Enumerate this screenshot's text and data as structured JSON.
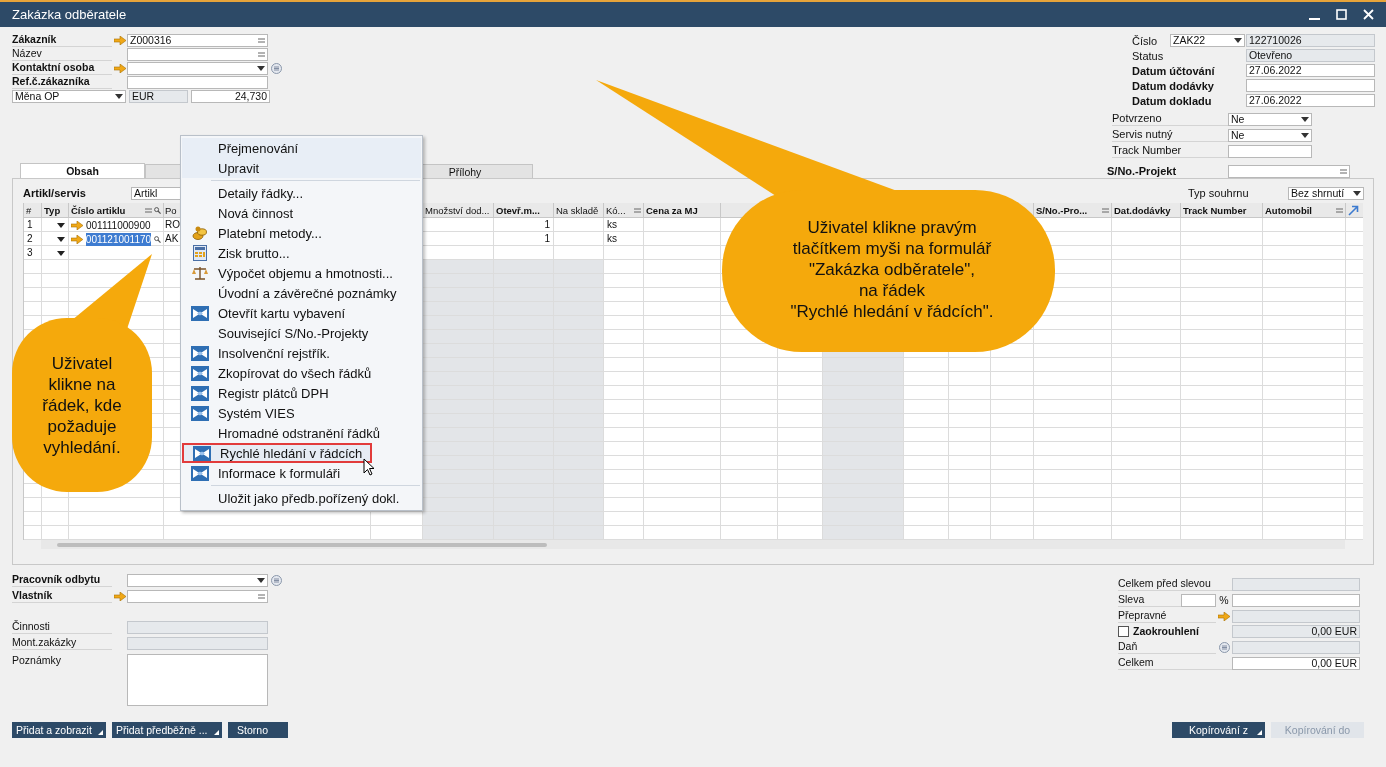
{
  "window": {
    "title": "Zakázka odběratele"
  },
  "customer": {
    "fields": [
      {
        "label": "Zákazník",
        "bold": true,
        "link": true,
        "list_button": true,
        "info": false,
        "kind": "text",
        "value": "Z000316"
      },
      {
        "label": "Název",
        "bold": false,
        "link": false,
        "list_button": true,
        "info": false,
        "kind": "text"
      },
      {
        "label": "Kontaktní osoba",
        "bold": true,
        "link": true,
        "list_button": false,
        "kind": "dropdown",
        "info": true
      },
      {
        "label": "Ref.č.zákazníka",
        "bold": true,
        "link": false,
        "list_button": false,
        "info": false,
        "kind": "text"
      }
    ],
    "currency": {
      "type": "Měna OP",
      "code": "EUR",
      "rate": "24,730"
    }
  },
  "document": {
    "fields": [
      {
        "label": "Číslo",
        "bold": false,
        "series": "ZAK22",
        "value": "122710026",
        "readonly": true
      },
      {
        "label": "Status",
        "bold": false,
        "value": "Otevřeno",
        "readonly": true
      },
      {
        "label": "Datum účtování",
        "bold": true,
        "value": "27.06.2022",
        "readonly": false
      },
      {
        "label": "Datum dodávky",
        "bold": true,
        "readonly": false
      },
      {
        "label": "Datum dokladu",
        "bold": true,
        "value": "27.06.2022",
        "readonly": false
      }
    ],
    "user_fields": [
      {
        "label": "Potvrzeno",
        "kind": "dropdown",
        "value": "Ne"
      },
      {
        "label": "Servis nutný",
        "kind": "dropdown",
        "value": "Ne"
      },
      {
        "label": "Track Number",
        "kind": "text"
      }
    ]
  },
  "tabs": [
    {
      "label": "Obsah",
      "selected": true
    },
    {
      "selected": false
    },
    {
      "label": "Přílohy",
      "selected": false
    }
  ],
  "project": {
    "label": "S/No.-Projekt"
  },
  "contents": {
    "item_type": {
      "label": "Artikl/servis",
      "value": "Artikl"
    },
    "summary": {
      "label": "Typ souhrnu",
      "value": "Bez shrnutí"
    },
    "columns": [
      {
        "label": "#",
        "bold": false,
        "menu": false,
        "search": false,
        "shaded": false
      },
      {
        "label": "Typ",
        "bold": true,
        "menu": false,
        "search": false,
        "shaded": false
      },
      {
        "label": "Číslo artiklu",
        "bold": true,
        "menu": true,
        "search": true,
        "shaded": false
      },
      {
        "label": "Po",
        "bold": false,
        "menu": false,
        "search": false,
        "shaded": false
      },
      {
        "shaded": false
      },
      {
        "label": "Množství dod...",
        "bold": false,
        "menu": false,
        "search": false,
        "shaded": true
      },
      {
        "label": "Otevř.m...",
        "bold": true,
        "menu": false,
        "search": false,
        "shaded": true
      },
      {
        "label": "Na skladě",
        "bold": false,
        "menu": false,
        "search": false,
        "shaded": true
      },
      {
        "label": "Kó...",
        "bold": false,
        "menu": true,
        "search": false,
        "shaded": false
      },
      {
        "label": "Cena za MJ",
        "bold": true,
        "menu": false,
        "search": false,
        "shaded": false
      },
      {
        "shaded": false
      },
      {
        "shaded": false
      },
      {
        "shaded": true
      },
      {
        "shaded": false
      },
      {
        "shaded": false
      },
      {
        "shaded": false
      },
      {
        "label": "S/No.-Pro...",
        "bold": true,
        "menu": true,
        "search": false,
        "shaded": false
      },
      {
        "label": "Dat.dodávky",
        "bold": true,
        "menu": false,
        "search": false,
        "shaded": false
      },
      {
        "label": "Track Number",
        "bold": true,
        "menu": false,
        "search": false,
        "shaded": false
      },
      {
        "label": "Automobil",
        "bold": true,
        "menu": true,
        "search": false,
        "shaded": false
      }
    ],
    "rows": [
      {
        "number": "1",
        "link": true,
        "item": "001111000900",
        "item_selected": false,
        "column_4": "RO",
        "open_qty": "1",
        "uom": "ks"
      },
      {
        "number": "2",
        "link": true,
        "item": "001121001170",
        "item_selected": true,
        "column_4": "AK",
        "open_qty": "1",
        "uom": "ks"
      },
      {
        "number": "3",
        "link": false,
        "item_selected": false
      }
    ]
  },
  "context_menu": {
    "items": [
      {
        "label": "Přejmenování",
        "kind": "plain",
        "separator_before": false,
        "highlighted": false
      },
      {
        "label": "Upravit",
        "kind": "plain",
        "separator_before": false,
        "highlighted": false
      },
      {
        "label": "Detaily řádky...",
        "kind": "plain",
        "separator_before": true,
        "highlighted": false
      },
      {
        "label": "Nová činnost",
        "kind": "plain",
        "separator_before": false,
        "highlighted": false
      },
      {
        "label": "Platební metody...",
        "kind": "coins",
        "separator_before": false,
        "highlighted": false
      },
      {
        "label": "Zisk brutto...",
        "kind": "calculator",
        "separator_before": false,
        "highlighted": false
      },
      {
        "label": "Výpočet objemu a hmotnosti...",
        "kind": "scale",
        "separator_before": false,
        "highlighted": false
      },
      {
        "label": "Úvodní a závěrečné poznámky",
        "kind": "plain",
        "separator_before": false,
        "highlighted": false
      },
      {
        "label": "Otevřít kartu vybavení",
        "kind": "app",
        "separator_before": false,
        "highlighted": false
      },
      {
        "label": "Související S/No.-Projekty",
        "kind": "plain",
        "separator_before": false,
        "highlighted": false
      },
      {
        "label": "Insolvenční rejstřík.",
        "kind": "app",
        "separator_before": false,
        "highlighted": false
      },
      {
        "label": "Zkopírovat do všech řádků",
        "kind": "app",
        "separator_before": false,
        "highlighted": false
      },
      {
        "label": "Registr plátců DPH",
        "kind": "app",
        "separator_before": false,
        "highlighted": false
      },
      {
        "label": "Systém VIES",
        "kind": "app",
        "separator_before": false,
        "highlighted": false
      },
      {
        "label": "Hromadné odstranění řádků",
        "kind": "plain",
        "separator_before": false,
        "highlighted": false
      },
      {
        "label": "Rychlé hledání v řádcích",
        "kind": "app",
        "separator_before": false,
        "highlighted": true
      },
      {
        "label": "Informace k formuláři",
        "kind": "app",
        "separator_before": false,
        "highlighted": false
      },
      {
        "label": "Uložit jako předb.pořízený dokl.",
        "kind": "plain",
        "separator_before": true,
        "highlighted": false
      }
    ]
  },
  "callouts": [
    {
      "text": "Uživatel klikne pravým\ntlačítkem myši na formulář\n\"Zakázka odběratele\",\nna řádek\n\"Rychlé hledání v řádcích\"."
    },
    {
      "text": "Uživatel\nklikne na\nřádek, kde\npožaduje\nvyhledání."
    }
  ],
  "sales": {
    "fields": [
      {
        "label": "Pracovník odbytu",
        "bold": true,
        "kind": "dropdown",
        "link": false,
        "info": true
      },
      {
        "label": "Vlastník",
        "bold": true,
        "kind": "text",
        "link": true,
        "info": false
      },
      {
        "label": "Činnosti",
        "bold": false,
        "kind": "readonly",
        "link": false,
        "info": false
      },
      {
        "label": "Mont.zakázky",
        "bold": false,
        "kind": "readonly",
        "link": false,
        "info": false
      },
      {
        "label": "Poznámky",
        "bold": false,
        "kind": "textarea",
        "link": false,
        "info": false
      }
    ]
  },
  "totals": [
    {
      "label": "Celkem před slevou",
      "bold": false,
      "kind": "readonly"
    },
    {
      "label": "Sleva",
      "bold": false,
      "kind": "percent",
      "unit": "%"
    },
    {
      "label": "Přepravné",
      "bold": false,
      "kind": "link"
    },
    {
      "label": "Zaokrouhlení",
      "bold": true,
      "kind": "checkbox",
      "checked": false,
      "value": "0,00 EUR"
    },
    {
      "label": "Daň",
      "bold": false,
      "kind": "info"
    },
    {
      "label": "Celkem",
      "bold": false,
      "kind": "total",
      "value": "0,00 EUR"
    }
  ],
  "buttons_left": [
    {
      "label": "Přidat a zobrazit",
      "menu": true,
      "disabled": false
    },
    {
      "label": "Přidat předběžně ...",
      "menu": true,
      "disabled": false
    },
    {
      "label": "Storno",
      "menu": false,
      "disabled": false
    }
  ],
  "buttons_right": [
    {
      "label": "Kopírování z",
      "menu": true,
      "disabled": false
    },
    {
      "label": "Kopírování do",
      "menu": false,
      "disabled": true
    }
  ]
}
